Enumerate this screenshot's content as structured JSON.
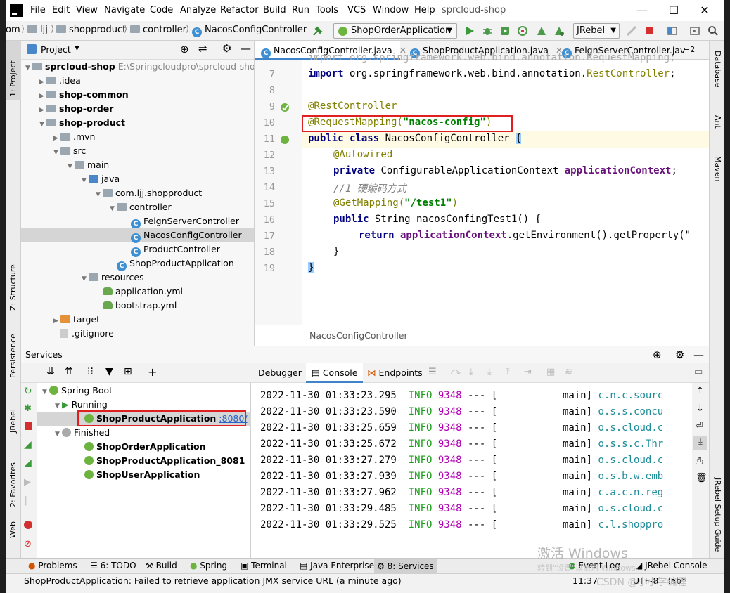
{
  "window": {
    "title": "sprcloud-shop",
    "menu": [
      "File",
      "Edit",
      "View",
      "Navigate",
      "Code",
      "Analyze",
      "Refactor",
      "Build",
      "Run",
      "Tools",
      "VCS",
      "Window",
      "Help"
    ],
    "controls": {
      "minimize": "—",
      "maximize": "☐",
      "close": "✕"
    }
  },
  "navbar": {
    "crumbs": [
      "om",
      "ljj",
      "shopproduct",
      "controller",
      "NacosConfigController"
    ],
    "run_config": "ShopOrderApplication",
    "jrebel": "JRebel"
  },
  "left_stripe": [
    "1: Project",
    "Z: Structure",
    "Persistence",
    "JRebel",
    "2: Favorites",
    "Web"
  ],
  "right_stripe": [
    "Database",
    "Ant",
    "Maven",
    "JRebel Setup Guide"
  ],
  "project": {
    "header": "Project",
    "root_name": "sprcloud-shop",
    "root_path": "E:\\Springcloudpro\\sprcloud-shop",
    "items": [
      {
        "label": ".idea",
        "indent": 1,
        "icon": "folder",
        "arrow": "▶",
        "bold": false
      },
      {
        "label": "shop-common",
        "indent": 1,
        "icon": "folder",
        "arrow": "▶",
        "bold": true
      },
      {
        "label": "shop-order",
        "indent": 1,
        "icon": "folder",
        "arrow": "▶",
        "bold": true
      },
      {
        "label": "shop-product",
        "indent": 1,
        "icon": "folder",
        "arrow": "▼",
        "bold": true
      },
      {
        "label": ".mvn",
        "indent": 2,
        "icon": "folder",
        "arrow": "▶",
        "bold": false
      },
      {
        "label": "src",
        "indent": 2,
        "icon": "folder",
        "arrow": "▼",
        "bold": false
      },
      {
        "label": "main",
        "indent": 3,
        "icon": "folder",
        "arrow": "▼",
        "bold": false
      },
      {
        "label": "java",
        "indent": 4,
        "icon": "folder-blue",
        "arrow": "▼",
        "bold": false
      },
      {
        "label": "com.ljj.shopproduct",
        "indent": 5,
        "icon": "folder",
        "arrow": "▼",
        "bold": false
      },
      {
        "label": "controller",
        "indent": 6,
        "icon": "folder",
        "arrow": "▼",
        "bold": false
      },
      {
        "label": "FeignServerController",
        "indent": 7,
        "icon": "class",
        "arrow": "",
        "bold": false
      },
      {
        "label": "NacosConfigController",
        "indent": 7,
        "icon": "class",
        "arrow": "",
        "bold": false,
        "selected": true
      },
      {
        "label": "ProductController",
        "indent": 7,
        "icon": "class",
        "arrow": "",
        "bold": false
      },
      {
        "label": "ShopProductApplication",
        "indent": 6,
        "icon": "class",
        "arrow": "",
        "bold": false
      },
      {
        "label": "resources",
        "indent": 4,
        "icon": "folder",
        "arrow": "▼",
        "bold": false
      },
      {
        "label": "application.yml",
        "indent": 5,
        "icon": "yml",
        "arrow": "",
        "bold": false
      },
      {
        "label": "bootstrap.yml",
        "indent": 5,
        "icon": "yml",
        "arrow": "",
        "bold": false
      },
      {
        "label": "target",
        "indent": 2,
        "icon": "target",
        "arrow": "▶",
        "bold": false
      },
      {
        "label": ".gitignore",
        "indent": 2,
        "icon": "file",
        "arrow": "",
        "bold": false
      }
    ]
  },
  "editor": {
    "tabs": [
      "NacosConfigController.java",
      "ShopProductApplication.java",
      "FeignServerController.jav"
    ],
    "tab_overflow": "≡2",
    "line_numbers": [
      "7",
      "8",
      "9",
      "10",
      "11",
      "12",
      "13",
      "14",
      "15",
      "16",
      "17",
      "18",
      "19"
    ],
    "code": {
      "l6": "import org.springframework.web.bind.annotation.RequestMapping;",
      "l7_kw": "import",
      "l7_pkg": " org.springframework.web.bind.annotation.",
      "l7_ann": "RestController",
      "l7_end": ";",
      "l9": "@RestController",
      "l10_ann": "@RequestMapping(",
      "l10_str": "\"nacos-config\"",
      "l10_end": ")",
      "l11_kw": "public class",
      "l11_rest": " NacosConfigController ",
      "l11_brace": "{",
      "l12": "@Autowired",
      "l13_kw": "private",
      "l13_type": " ConfigurableApplicationContext ",
      "l13_field": "applicationContext",
      "l13_end": ";",
      "l14": "//1 硬编码方式",
      "l15_ann": "@GetMapping(",
      "l15_str": "\"/test1\"",
      "l15_end": ")",
      "l16_kw": "public",
      "l16_rest": " String nacosConfingTest1() {",
      "l17_kw": "return",
      "l17_field": " applicationContext",
      "l17_rest": ".getEnvironment().getProperty(\"",
      "l18": "}",
      "l19": "}"
    },
    "breadcrumb": "NacosConfigController"
  },
  "services": {
    "title": "Services",
    "tree": {
      "spring_boot": "Spring Boot",
      "running": "Running",
      "running_app": "ShopProductApplication",
      "running_port": ":8080/",
      "finished": "Finished",
      "finished_apps": [
        "ShopOrderApplication",
        "ShopProductApplication_8081",
        "ShopUserApplication"
      ]
    },
    "console_tabs": [
      "Debugger",
      "Console",
      "Endpoints"
    ],
    "logs": [
      {
        "ts": "2022-11-30 01:33:23.295",
        "level": "INFO",
        "pid": "9348",
        "sep": "---",
        "thread": "[           main]",
        "logger": "c.n.c.sourc"
      },
      {
        "ts": "2022-11-30 01:33:23.590",
        "level": "INFO",
        "pid": "9348",
        "sep": "---",
        "thread": "[           main]",
        "logger": "o.s.s.concu"
      },
      {
        "ts": "2022-11-30 01:33:25.659",
        "level": "INFO",
        "pid": "9348",
        "sep": "---",
        "thread": "[           main]",
        "logger": "o.s.cloud.c"
      },
      {
        "ts": "2022-11-30 01:33:25.672",
        "level": "INFO",
        "pid": "9348",
        "sep": "---",
        "thread": "[           main]",
        "logger": "o.s.s.c.Thr"
      },
      {
        "ts": "2022-11-30 01:33:27.279",
        "level": "INFO",
        "pid": "9348",
        "sep": "---",
        "thread": "[           main]",
        "logger": "o.s.cloud.c"
      },
      {
        "ts": "2022-11-30 01:33:27.939",
        "level": "INFO",
        "pid": "9348",
        "sep": "---",
        "thread": "[           main]",
        "logger": "o.s.b.w.emb"
      },
      {
        "ts": "2022-11-30 01:33:27.962",
        "level": "INFO",
        "pid": "9348",
        "sep": "---",
        "thread": "[           main]",
        "logger": "c.a.c.n.reg"
      },
      {
        "ts": "2022-11-30 01:33:29.485",
        "level": "INFO",
        "pid": "9348",
        "sep": "---",
        "thread": "[           main]",
        "logger": "o.s.cloud.c"
      },
      {
        "ts": "2022-11-30 01:33:29.525",
        "level": "INFO",
        "pid": "9348",
        "sep": "---",
        "thread": "[           main]",
        "logger": "c.l.shoppro"
      }
    ]
  },
  "bottom_tools": [
    "Problems",
    "6: TODO",
    "Build",
    "Spring",
    "Terminal",
    "Java Enterprise",
    "8: Services",
    "Event Log",
    "JRebel Console"
  ],
  "status": {
    "message": "ShopProductApplication: Failed to retrieve application JMX service URL (a minute ago)",
    "position": "11:37",
    "encoding": "UTF-8",
    "indent": "Tab*"
  },
  "watermark": {
    "line1": "激活 Windows",
    "line2": "转到\"设置\"以激活 Windows。",
    "csdn": "CSDN @小小学编程"
  },
  "colors": {
    "accent": "#4083c9",
    "highlight_box": "#e02020",
    "log_info": "#1a9e1a",
    "log_pid": "#b000b0",
    "log_logger": "#1e8c99"
  }
}
